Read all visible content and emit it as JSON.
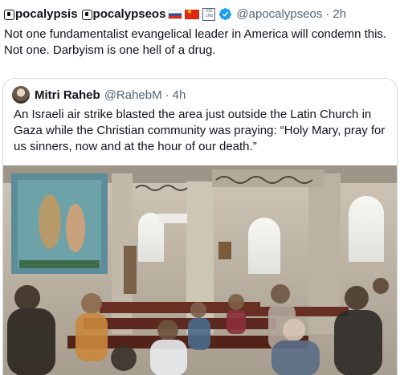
{
  "tweet": {
    "author_name": "pocalypsis",
    "author_name_2": "pocalypseos",
    "flags": [
      "ru-flag",
      "cn-flag"
    ],
    "box_icon_text": "01E\n1N8",
    "handle": "@apocalypseos",
    "separator": "·",
    "time": "2h",
    "text_line1": "Not one fundamentalist evangelical leader in America will condemn this.",
    "text_line2": "Not one. Darbyism is one hell of a drug."
  },
  "quote": {
    "author_name": "Mitri Raheb",
    "handle": "@RahebM",
    "separator": "·",
    "time": "4h",
    "text_line1": "An Israeli air strike blasted the area just outside the Latin Church in",
    "text_line2": "Gaza while the Christian community was praying: “Holy Mary, pray for",
    "text_line3": "us sinners, now and at the hour of our death.”",
    "media_description": "church-interior-video-still"
  },
  "colors": {
    "text": "#0f1419",
    "secondary": "#536471",
    "verified": "#1d9bf0",
    "border": "#cfd9de"
  }
}
